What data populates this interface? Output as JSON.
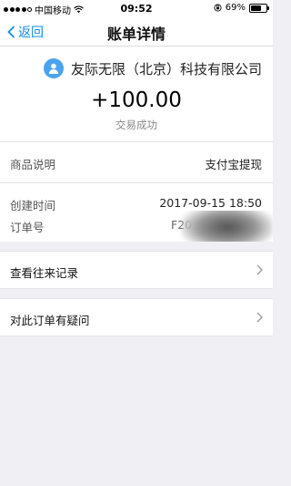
{
  "status_bar": {
    "carrier": "中国移动",
    "time": "09:52",
    "battery": "69%",
    "battery_level": 0.69
  },
  "nav": {
    "back_label": "返回",
    "title": "账单详情"
  },
  "merchant": {
    "name": "友际无限（北京）科技有限公司"
  },
  "transaction": {
    "amount": "+100.00",
    "status": "交易成功"
  },
  "details": {
    "product_label": "商品说明",
    "product_value": "支付宝提现",
    "created_label": "创建时间",
    "created_value": "2017-09-15 18:50",
    "order_label": "订单号",
    "order_value": "F20"
  },
  "actions": {
    "history_label": "查看往来记录",
    "dispute_label": "对此订单有疑问"
  },
  "colors": {
    "accent": "#108ee9",
    "avatar": "#4aa3ee",
    "background": "#efeff4"
  }
}
